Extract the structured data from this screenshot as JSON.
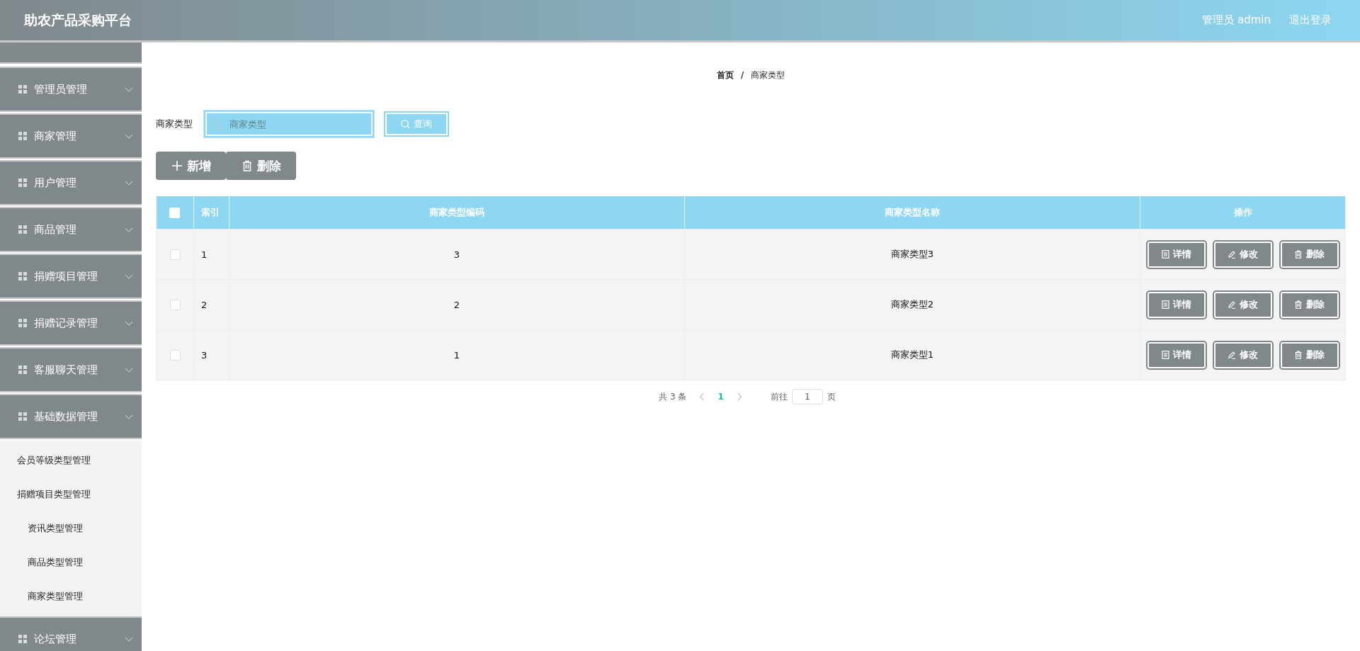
{
  "header": {
    "title": "助农产品采购平台",
    "user": "管理员 admin",
    "logout": "退出登录"
  },
  "sidebar": {
    "items": [
      {
        "label": "管理员管理"
      },
      {
        "label": "商家管理"
      },
      {
        "label": "用户管理"
      },
      {
        "label": "商品管理"
      },
      {
        "label": "捐赠项目管理"
      },
      {
        "label": "捐赠记录管理"
      },
      {
        "label": "客服聊天管理"
      },
      {
        "label": "基础数据管理",
        "children": [
          {
            "label": "会员等级类型管理",
            "indented": false
          },
          {
            "label": "捐赠项目类型管理",
            "indented": false
          },
          {
            "label": "资讯类型管理",
            "indented": true
          },
          {
            "label": "商品类型管理",
            "indented": true
          },
          {
            "label": "商家类型管理",
            "indented": true
          }
        ]
      },
      {
        "label": "论坛管理"
      }
    ]
  },
  "breadcrumb": {
    "items": [
      "首页",
      "商家类型"
    ],
    "separator": "/"
  },
  "search": {
    "label": "商家类型",
    "placeholder": "商家类型",
    "button": "查询"
  },
  "actions": [
    {
      "kind": "add",
      "label": "新增"
    },
    {
      "kind": "delete",
      "label": "删除"
    }
  ],
  "table": {
    "select_all_checked": false,
    "columns": [
      "索引",
      "商家类型编码",
      "商家类型名称",
      "操作"
    ],
    "rows": [
      {
        "checked": false,
        "index": "1",
        "code": "3",
        "name": "商家类型3",
        "actions": [
          {
            "kind": "detail",
            "label": "详情"
          },
          {
            "kind": "edit",
            "label": "修改"
          },
          {
            "kind": "delete",
            "label": "删除"
          }
        ]
      },
      {
        "checked": false,
        "index": "2",
        "code": "2",
        "name": "商家类型2",
        "actions": [
          {
            "kind": "detail",
            "label": "详情"
          },
          {
            "kind": "edit",
            "label": "修改"
          },
          {
            "kind": "delete",
            "label": "删除"
          }
        ]
      },
      {
        "checked": false,
        "index": "3",
        "code": "1",
        "name": "商家类型1",
        "actions": [
          {
            "kind": "detail",
            "label": "详情"
          },
          {
            "kind": "edit",
            "label": "修改"
          },
          {
            "kind": "delete",
            "label": "删除"
          }
        ]
      }
    ]
  },
  "pagination": {
    "total": "共 3 条",
    "pages": [
      {
        "label": "1",
        "selected": true
      }
    ],
    "goto_label": "前往",
    "goto_value": "1",
    "page_unit": "页"
  }
}
